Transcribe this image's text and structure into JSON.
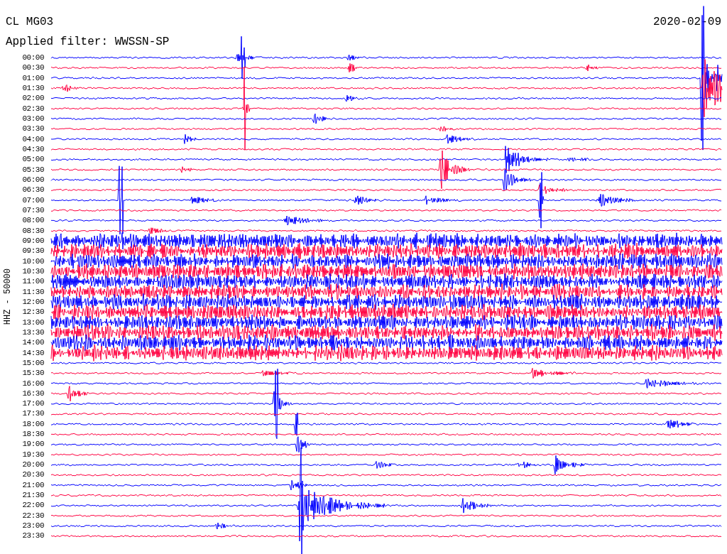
{
  "header": {
    "station": "CL MG03",
    "date": "2020-02-09",
    "filter": "Applied filter: WWSSN-SP"
  },
  "axis_label": "HHZ - 50000",
  "traces": [
    {
      "time": "00:00",
      "color": "#0000ff"
    },
    {
      "time": "00:30",
      "color": "#ff0040"
    },
    {
      "time": "01:00",
      "color": "#0000ff"
    },
    {
      "time": "01:30",
      "color": "#ff0040"
    },
    {
      "time": "02:00",
      "color": "#0000ff"
    },
    {
      "time": "02:30",
      "color": "#ff0040"
    },
    {
      "time": "03:00",
      "color": "#0000ff"
    },
    {
      "time": "03:30",
      "color": "#ff0040"
    },
    {
      "time": "04:00",
      "color": "#0000ff"
    },
    {
      "time": "04:30",
      "color": "#ff0040"
    },
    {
      "time": "05:00",
      "color": "#0000ff"
    },
    {
      "time": "05:30",
      "color": "#ff0040"
    },
    {
      "time": "06:00",
      "color": "#0000ff"
    },
    {
      "time": "06:30",
      "color": "#ff0040"
    },
    {
      "time": "07:00",
      "color": "#0000ff"
    },
    {
      "time": "07:30",
      "color": "#ff0040"
    },
    {
      "time": "08:00",
      "color": "#0000ff"
    },
    {
      "time": "08:30",
      "color": "#ff0040"
    },
    {
      "time": "09:00",
      "color": "#0000ff"
    },
    {
      "time": "09:30",
      "color": "#ff0040"
    },
    {
      "time": "10:00",
      "color": "#0000ff"
    },
    {
      "time": "10:30",
      "color": "#ff0040"
    },
    {
      "time": "11:00",
      "color": "#0000ff"
    },
    {
      "time": "11:30",
      "color": "#ff0040"
    },
    {
      "time": "12:00",
      "color": "#0000ff"
    },
    {
      "time": "12:30",
      "color": "#ff0040"
    },
    {
      "time": "13:00",
      "color": "#0000ff"
    },
    {
      "time": "13:30",
      "color": "#ff0040"
    },
    {
      "time": "14:00",
      "color": "#0000ff"
    },
    {
      "time": "14:30",
      "color": "#ff0040"
    },
    {
      "time": "15:00",
      "color": "#0000ff"
    },
    {
      "time": "15:30",
      "color": "#ff0040"
    },
    {
      "time": "16:00",
      "color": "#0000ff"
    },
    {
      "time": "16:30",
      "color": "#ff0040"
    },
    {
      "time": "17:00",
      "color": "#0000ff"
    },
    {
      "time": "17:30",
      "color": "#ff0040"
    },
    {
      "time": "18:00",
      "color": "#0000ff"
    },
    {
      "time": "18:30",
      "color": "#ff0040"
    },
    {
      "time": "19:00",
      "color": "#0000ff"
    },
    {
      "time": "19:30",
      "color": "#ff0040"
    },
    {
      "time": "20:00",
      "color": "#0000ff"
    },
    {
      "time": "20:30",
      "color": "#ff0040"
    },
    {
      "time": "21:00",
      "color": "#0000ff"
    },
    {
      "time": "21:30",
      "color": "#ff0040"
    },
    {
      "time": "22:00",
      "color": "#0000ff"
    },
    {
      "time": "22:30",
      "color": "#ff0040"
    },
    {
      "time": "23:00",
      "color": "#0000ff"
    },
    {
      "time": "23:30",
      "color": "#ff0040"
    }
  ]
}
